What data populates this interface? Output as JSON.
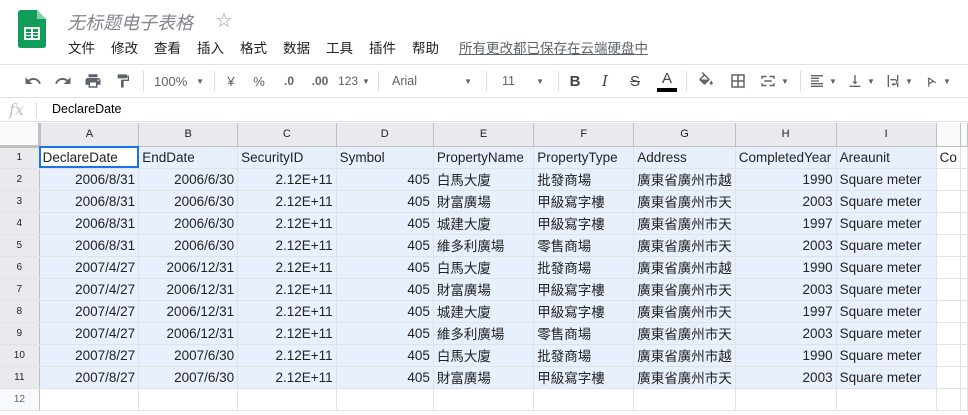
{
  "app": {
    "title": "无标题电子表格",
    "star": "☆",
    "save_status": "所有更改都已保存在云端硬盘中",
    "menus": [
      "文件",
      "修改",
      "查看",
      "插入",
      "格式",
      "数据",
      "工具",
      "插件",
      "帮助"
    ]
  },
  "toolbar": {
    "zoom": "100%",
    "currency": "¥",
    "percent": "%",
    "decrease_decimal": ".0",
    "increase_decimal": ".00",
    "more_formats": "123",
    "font": "Arial",
    "font_size": "11",
    "bold": "B",
    "italic": "I",
    "strikethrough": "S",
    "text_color": "A"
  },
  "formula_bar": {
    "fx": "fx",
    "value": "DeclareDate"
  },
  "grid": {
    "columns": [
      "A",
      "B",
      "C",
      "D",
      "E",
      "F",
      "G",
      "H",
      "I"
    ],
    "header_row": [
      "DeclareDate",
      "EndDate",
      "SecurityID",
      "Symbol",
      "PropertyName",
      "PropertyType",
      "Address",
      "CompletedYear",
      "Areaunit",
      "Co"
    ],
    "rows": [
      [
        "2006/8/31",
        "2006/6/30",
        "2.12E+11",
        "405",
        "白馬大廈",
        "批發商場",
        "廣東省廣州市越",
        "1990",
        "Square meter"
      ],
      [
        "2006/8/31",
        "2006/6/30",
        "2.12E+11",
        "405",
        "財富廣場",
        "甲級寫字樓",
        "廣東省廣州市天",
        "2003",
        "Square meter"
      ],
      [
        "2006/8/31",
        "2006/6/30",
        "2.12E+11",
        "405",
        "城建大廈",
        "甲級寫字樓",
        "廣東省廣州市天",
        "1997",
        "Square meter"
      ],
      [
        "2006/8/31",
        "2006/6/30",
        "2.12E+11",
        "405",
        "維多利廣場",
        "零售商場",
        "廣東省廣州市天",
        "2003",
        "Square meter"
      ],
      [
        "2007/4/27",
        "2006/12/31",
        "2.12E+11",
        "405",
        "白馬大廈",
        "批發商場",
        "廣東省廣州市越",
        "1990",
        "Square meter"
      ],
      [
        "2007/4/27",
        "2006/12/31",
        "2.12E+11",
        "405",
        "財富廣場",
        "甲級寫字樓",
        "廣東省廣州市天",
        "2003",
        "Square meter"
      ],
      [
        "2007/4/27",
        "2006/12/31",
        "2.12E+11",
        "405",
        "城建大廈",
        "甲級寫字樓",
        "廣東省廣州市天",
        "1997",
        "Square meter"
      ],
      [
        "2007/4/27",
        "2006/12/31",
        "2.12E+11",
        "405",
        "維多利廣場",
        "零售商場",
        "廣東省廣州市天",
        "2003",
        "Square meter"
      ],
      [
        "2007/8/27",
        "2007/6/30",
        "2.12E+11",
        "405",
        "白馬大廈",
        "批發商場",
        "廣東省廣州市越",
        "1990",
        "Square meter"
      ],
      [
        "2007/8/27",
        "2007/6/30",
        "2.12E+11",
        "405",
        "財富廣場",
        "甲級寫字樓",
        "廣東省廣州市天",
        "2003",
        "Square meter"
      ]
    ],
    "row_numbers": [
      "1",
      "2",
      "3",
      "4",
      "5",
      "6",
      "7",
      "8",
      "9",
      "10",
      "11",
      "12"
    ]
  },
  "colors": {
    "selection": "#e8f0fe",
    "active_border": "#1a73e8",
    "logo_green": "#0f9d58"
  }
}
